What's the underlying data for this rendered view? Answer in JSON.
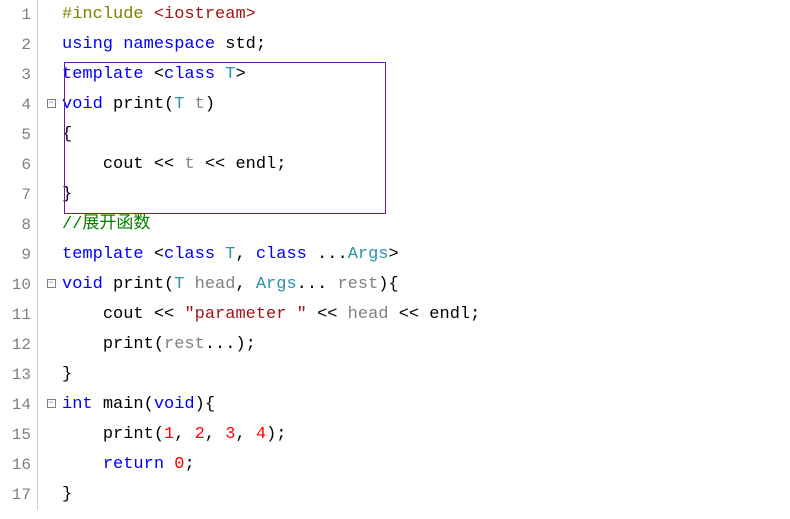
{
  "lineNumbers": [
    "1",
    "2",
    "3",
    "4",
    "5",
    "6",
    "7",
    "8",
    "9",
    "10",
    "11",
    "12",
    "13",
    "14",
    "15",
    "16",
    "17"
  ],
  "fold": {
    "minus": "−",
    "pipe": "│",
    "end": "└"
  },
  "code": {
    "l1": {
      "include": "#include",
      "file": "<iostream>"
    },
    "l2": {
      "using": "using",
      "namespace": "namespace",
      "std": "std",
      "semi": ";"
    },
    "l3": {
      "template": "template",
      "lt": "<",
      "class": "class",
      "T": "T",
      "gt": ">"
    },
    "l4": {
      "void": "void",
      "fn": "print",
      "lp": "(",
      "T": "T",
      "t": "t",
      "rp": ")"
    },
    "l5": {
      "brace": "{"
    },
    "l6": {
      "cout": "cout",
      "op": "<<",
      "t": "t",
      "endl": "endl",
      "semi": ";"
    },
    "l7": {
      "brace": "}"
    },
    "l8": {
      "comment": "//展开函数"
    },
    "l9": {
      "template": "template",
      "lt": "<",
      "class": "class",
      "T": "T",
      "comma": ",",
      "class2": "class",
      "dots": "...",
      "Args": "Args",
      "gt": ">"
    },
    "l10": {
      "void": "void",
      "fn": "print",
      "lp": "(",
      "T": "T",
      "head": "head",
      "comma": ",",
      "Args": "Args",
      "dots": "...",
      "rest": "rest",
      "rp": ")",
      "brace": "{"
    },
    "l11": {
      "cout": "cout",
      "op": "<<",
      "str": "\"parameter \"",
      "head": "head",
      "endl": "endl",
      "semi": ";"
    },
    "l12": {
      "fn": "print",
      "lp": "(",
      "rest": "rest",
      "dots": "...",
      "rp": ")",
      "semi": ";"
    },
    "l13": {
      "brace": "}"
    },
    "l14": {
      "int": "int",
      "main": "main",
      "lp": "(",
      "void": "void",
      "rp": ")",
      "brace": "{"
    },
    "l15": {
      "fn": "print",
      "lp": "(",
      "a1": "1",
      "c": ",",
      "a2": "2",
      "a3": "3",
      "a4": "4",
      "rp": ")",
      "semi": ";"
    },
    "l16": {
      "return": "return",
      "zero": "0",
      "semi": ";"
    },
    "l17": {
      "brace": "}"
    }
  }
}
